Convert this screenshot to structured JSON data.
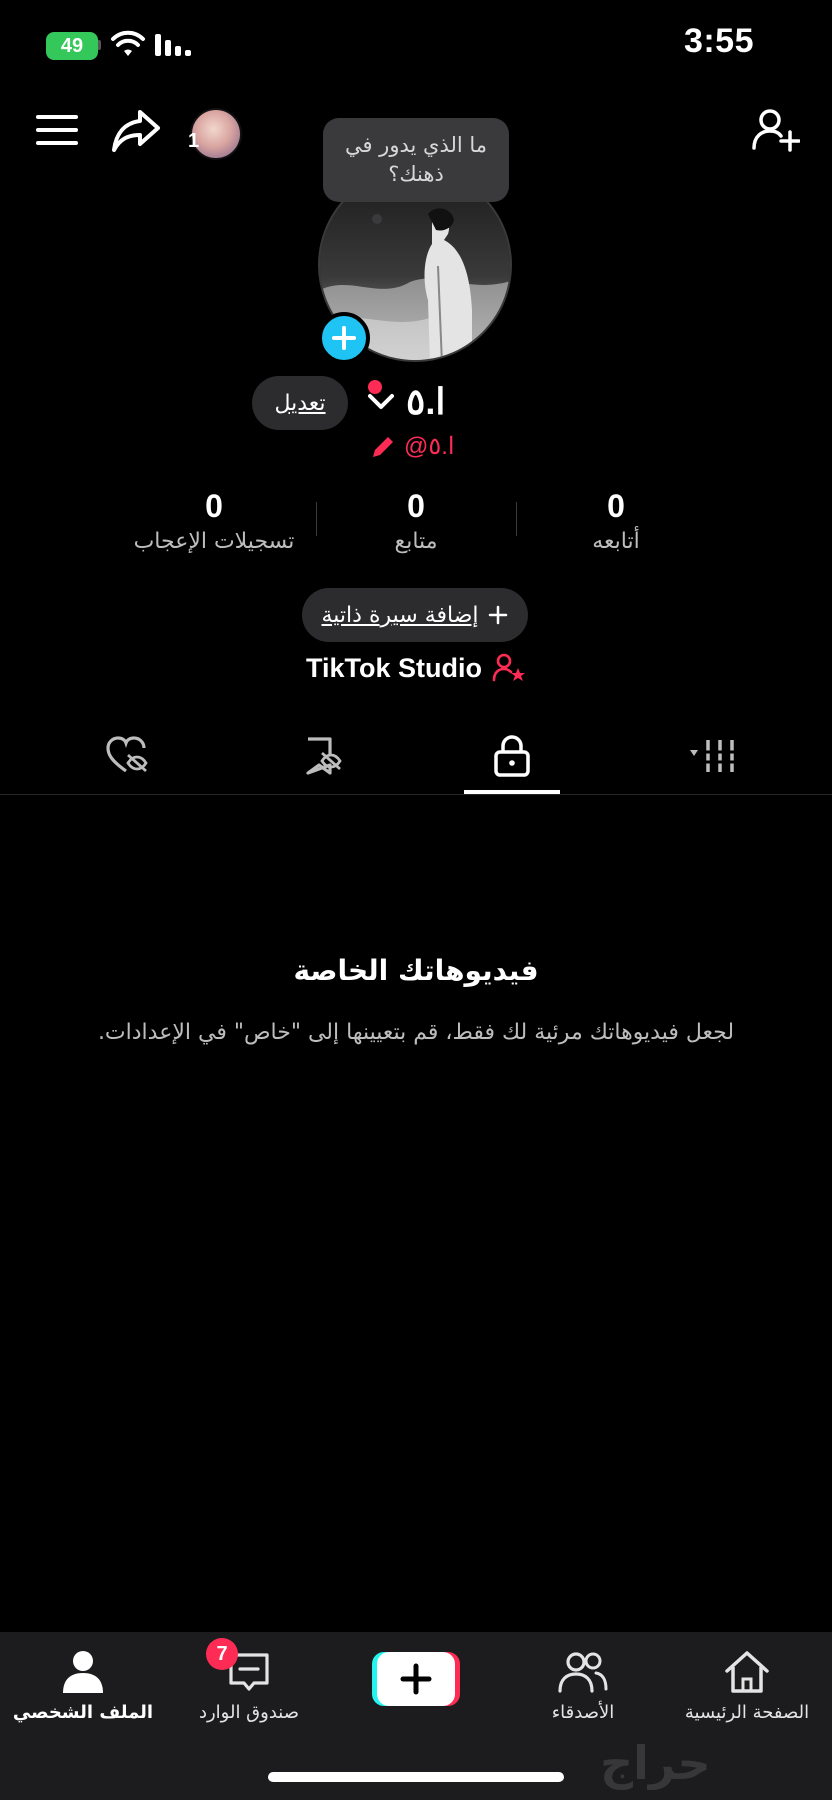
{
  "status_bar": {
    "time": "3:55",
    "battery": "49"
  },
  "header": {
    "story_count": "1"
  },
  "profile": {
    "bubble_text": "ما الذي يدور في ذهنك؟",
    "display_name": "ا.٥",
    "handle": "@ا.٥",
    "edit_label": "تعديل",
    "add_bio_label": "إضافة سيرة ذاتية",
    "studio_label": "TikTok Studio"
  },
  "stats": [
    {
      "value": "0",
      "label": "أتابعه"
    },
    {
      "value": "0",
      "label": "متابع"
    },
    {
      "value": "0",
      "label": "تسجيلات الإعجاب"
    }
  ],
  "tabs": [
    {
      "name": "videos-grid",
      "icon": "grid-icon"
    },
    {
      "name": "private",
      "icon": "lock-icon",
      "active": true
    },
    {
      "name": "saved",
      "icon": "bookmark-hidden-icon"
    },
    {
      "name": "liked",
      "icon": "heart-hidden-icon"
    }
  ],
  "empty_state": {
    "title": "فيديوهاتك الخاصة",
    "description": "لجعل فيديوهاتك مرئية لك فقط، قم بتعيينها إلى \"خاص\" في الإعدادات."
  },
  "bottom_nav": {
    "home": "الصفحة الرئيسية",
    "friends": "الأصدقاء",
    "inbox": "صندوق الوارد",
    "inbox_badge": "7",
    "profile": "الملف الشخصي"
  },
  "watermark": "حراج",
  "colors": {
    "accent_red": "#fe2c55",
    "accent_cyan": "#20c4f4",
    "background": "#000000"
  }
}
